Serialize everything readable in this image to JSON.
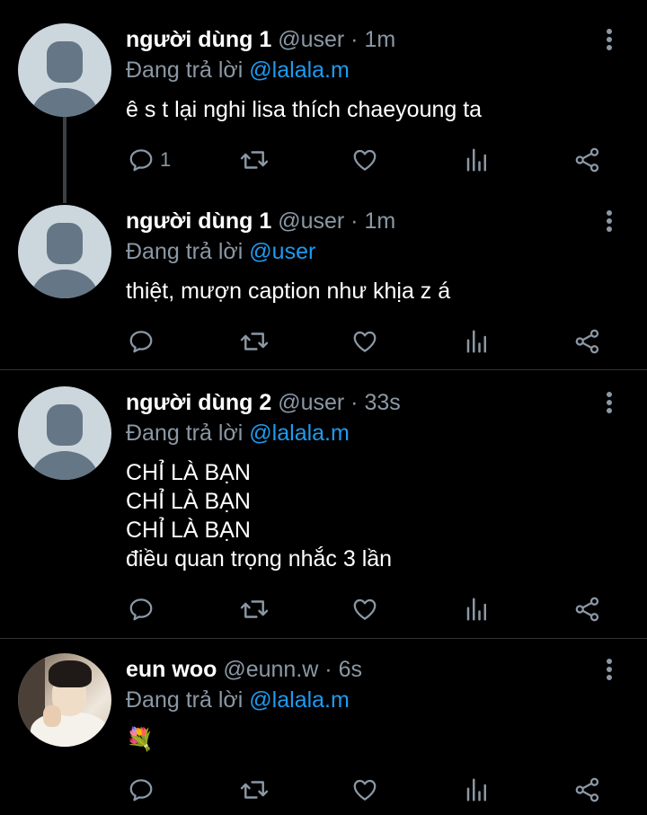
{
  "colors": {
    "background": "#000000",
    "name": "#ffffff",
    "muted": "#8b98a5",
    "mention": "#1d9bf0",
    "divider": "#2f3336"
  },
  "tweets": [
    {
      "name": "người dùng 1",
      "handle": "@user",
      "time": "1m",
      "replying_prefix": "Đang trả lời",
      "replying_to": "@lalala.m",
      "lines": [
        "ê s t lại nghi lisa thích chaeyoung ta"
      ],
      "reply_count": "1",
      "avatar": "default-avatar-icon"
    },
    {
      "name": "người dùng 1",
      "handle": "@user",
      "time": "1m",
      "replying_prefix": "Đang trả lời",
      "replying_to": "@user",
      "lines": [
        "thiệt, mượn caption như khịa z á"
      ],
      "reply_count": "",
      "avatar": "default-avatar-icon"
    },
    {
      "name": "người dùng 2",
      "handle": "@user",
      "time": "33s",
      "replying_prefix": "Đang trả lời",
      "replying_to": "@lalala.m",
      "lines": [
        "CHỈ LÀ BẠN",
        "CHỈ LÀ BẠN",
        "CHỈ LÀ BẠN",
        "điều quan trọng nhắc 3 lần"
      ],
      "reply_count": "",
      "avatar": "default-avatar-icon"
    },
    {
      "name": "eun woo",
      "handle": "@eunn.w",
      "time": "6s",
      "replying_prefix": "Đang trả lời",
      "replying_to": "@lalala.m",
      "lines": [
        "💐"
      ],
      "reply_count": "",
      "avatar": "profile-photo"
    }
  ],
  "separator": "·",
  "icons": {
    "reply": "reply-icon",
    "retweet": "retweet-icon",
    "like": "heart-icon",
    "analytics": "analytics-icon",
    "share": "share-icon",
    "more": "more-vertical-icon"
  }
}
